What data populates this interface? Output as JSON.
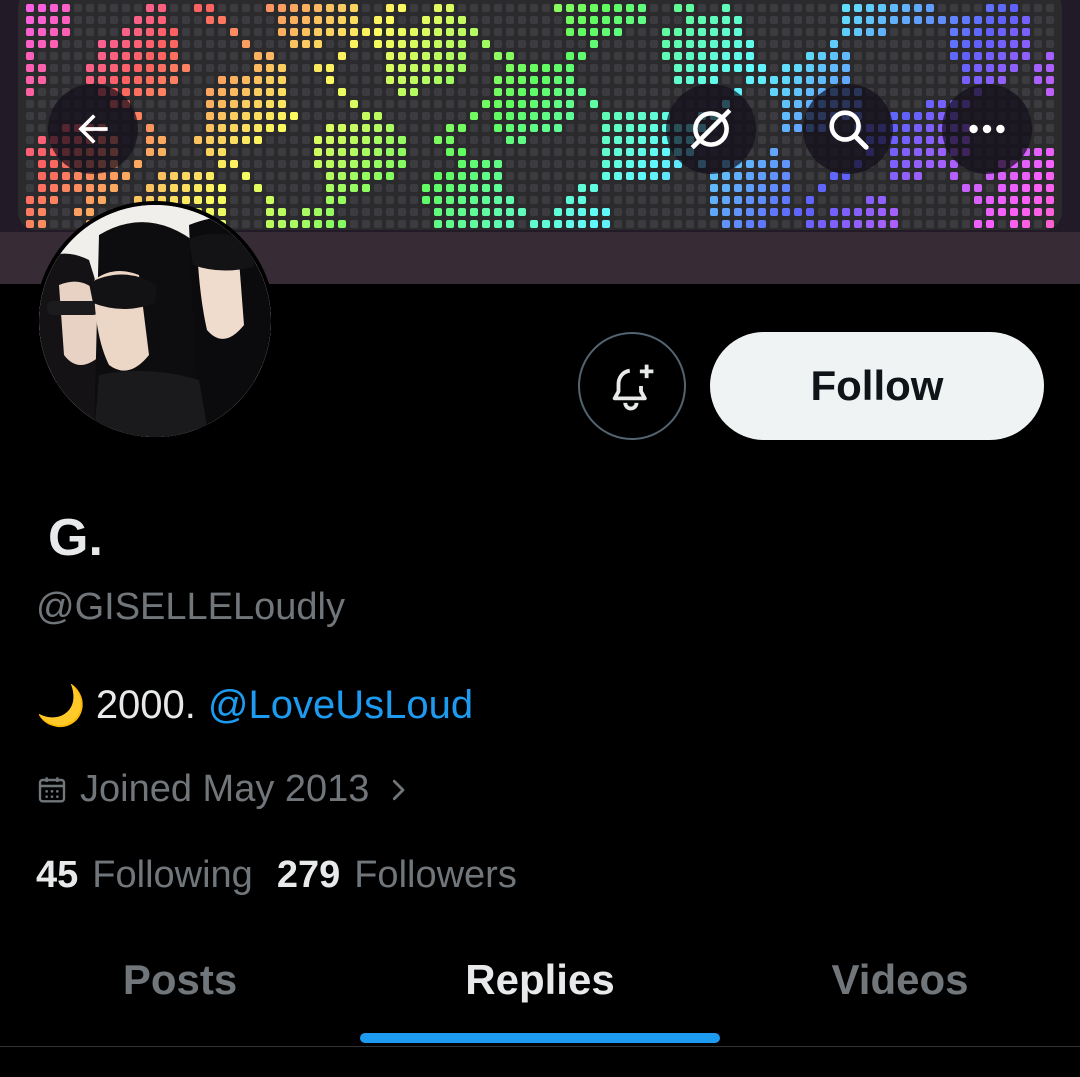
{
  "header": {
    "back_icon": "arrow-left-icon",
    "grok_icon": "grok-icon",
    "search_icon": "search-icon",
    "more_icon": "more-horizontal-icon"
  },
  "profile": {
    "display_name": "G.",
    "handle": "@GISELLELoudly",
    "bio_emoji": "🌙",
    "bio_text": "2000.",
    "bio_mention": "@LoveUsLoud",
    "joined": "Joined May 2013",
    "following_count": "45",
    "following_label": "Following",
    "followers_count": "279",
    "followers_label": "Followers"
  },
  "actions": {
    "notify_icon": "bell-plus-icon",
    "follow_label": "Follow"
  },
  "tabs": [
    {
      "label": "Posts",
      "active": false
    },
    {
      "label": "Replies",
      "active": true
    },
    {
      "label": "Videos",
      "active": false
    }
  ],
  "colors": {
    "background": "#000000",
    "text_primary": "#e7e9ea",
    "text_secondary": "#71767b",
    "accent": "#1d9bf0",
    "follow_button": "#eff3f4"
  }
}
